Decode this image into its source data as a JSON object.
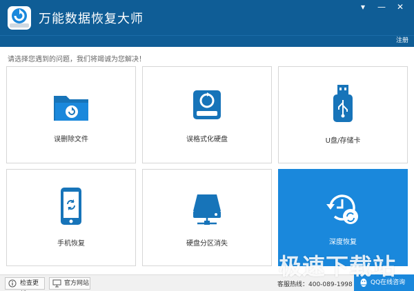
{
  "app": {
    "title": "万能数据恢复大师",
    "register_label": "注册",
    "icon": "app-logo-icon"
  },
  "window_controls": {
    "menu": "▾",
    "minimize": "—",
    "close": "✕"
  },
  "prompt": "请选择您遇到的问题，我们将竭诚为您解决！",
  "tiles": [
    {
      "label": "误删除文件",
      "icon": "folder-restore-icon"
    },
    {
      "label": "误格式化硬盘",
      "icon": "hard-drive-restore-icon"
    },
    {
      "label": "U盘/存储卡",
      "icon": "usb-drive-icon"
    },
    {
      "label": "手机恢复",
      "icon": "phone-restore-icon"
    },
    {
      "label": "硬盘分区消失",
      "icon": "disk-partition-icon"
    },
    {
      "label": "深度恢复",
      "icon": "deep-restore-clock-icon"
    }
  ],
  "footer": {
    "check_update": "检查更新",
    "official_site": "官方网站",
    "hotline": "客服热线：400-089-1998",
    "qq_consult": "QQ在线咨询"
  },
  "watermark": "极速下载站",
  "colors": {
    "titlebar": "#0f5d96",
    "accent": "#1a88dc",
    "icon_blue": "#1774b9"
  }
}
